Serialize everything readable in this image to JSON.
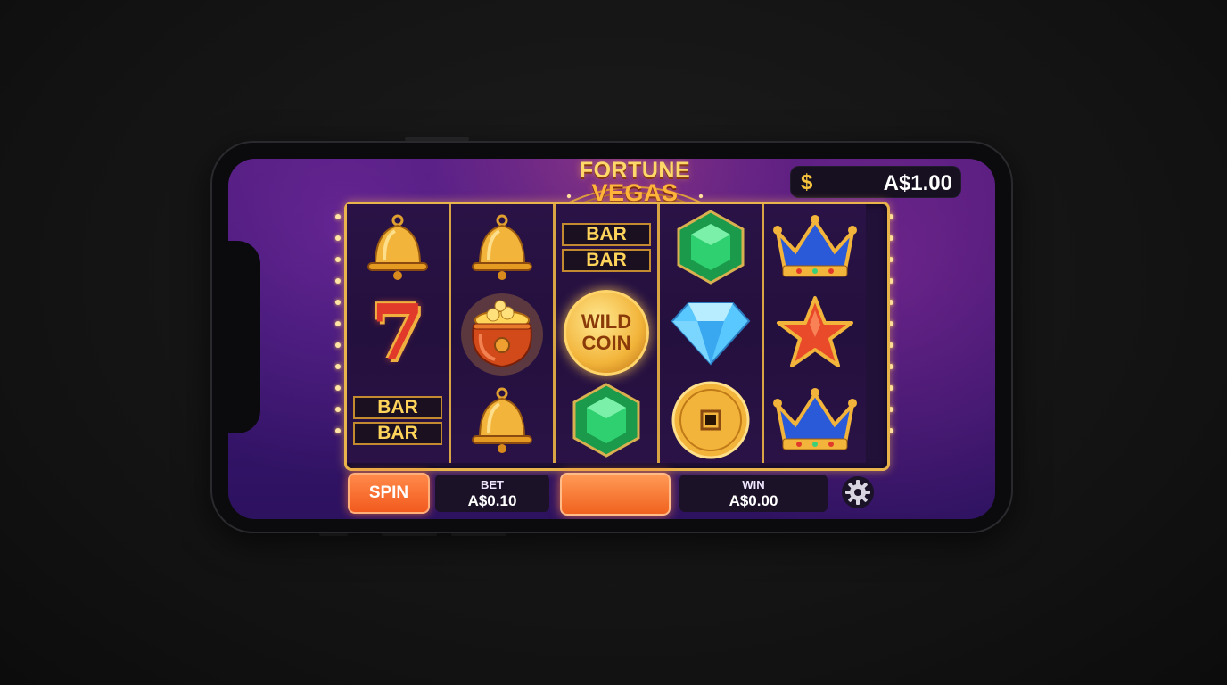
{
  "game": {
    "title_line1": "FORTUNE",
    "title_line2": "VEGAS"
  },
  "balance": {
    "currency_symbol": "$",
    "amount": "A$1.00"
  },
  "reels": [
    [
      "bell",
      "seven",
      "double-bar"
    ],
    [
      "bell",
      "pot-of-gold",
      "bell"
    ],
    [
      "double-bar",
      "wild-coin",
      "emerald"
    ],
    [
      "emerald",
      "diamond",
      "chinese-coin"
    ],
    [
      "crown",
      "star",
      "crown"
    ]
  ],
  "symbols": {
    "bar_text": "BAR",
    "seven_text": "7",
    "wild_line1": "WILD",
    "wild_line2": "COIN"
  },
  "controls": {
    "spin_label": "SPIN",
    "bet_label": "BET",
    "bet_value": "A$0.10",
    "win_label": "WIN",
    "win_value": "A$0.00",
    "settings_icon": "gear-icon"
  },
  "colors": {
    "accent": "#f25a1e",
    "gold": "#e9b44c",
    "background": "#3b1670"
  }
}
